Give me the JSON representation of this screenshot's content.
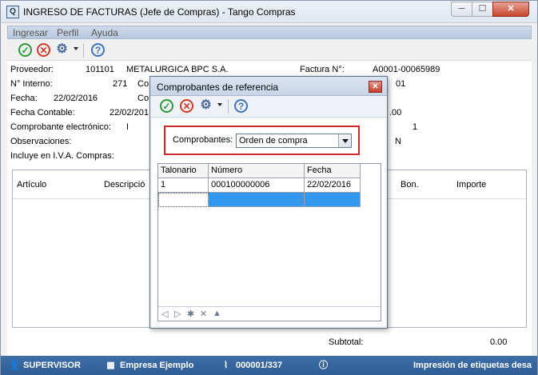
{
  "window": {
    "title": "INGRESO DE FACTURAS (Jefe de Compras) - Tango Compras",
    "controls": {
      "minimize": "─",
      "maximize": "☐",
      "close": "✕"
    }
  },
  "menu": [
    "Ingresar",
    "Perfil",
    "Ayuda"
  ],
  "form": {
    "proveedor_label": "Proveedor:",
    "proveedor_code": "101101",
    "proveedor_name": "METALURGICA BPC S.A.",
    "factura_label": "Factura N°:",
    "factura_value": "A0001-00065989",
    "interno_label": "N° Interno:",
    "interno_value": "271",
    "interno_right_partial": "Co",
    "right_partial_1": "01",
    "fecha_label": "Fecha:",
    "fecha_value": "22/02/2016",
    "fecha_right_partial": "Co",
    "fecha_contable_label": "Fecha Contable:",
    "fecha_contable_value": "22/02/201",
    "right_partial_2": ".00",
    "comprobante_electronico_label": "Comprobante electrónico:",
    "comprobante_electronico_partial": "I",
    "right_partial_3": "1",
    "observaciones_label": "Observaciones:",
    "right_partial_4": "N",
    "iva_label": "Incluye en I.V.A. Compras:"
  },
  "detail_table": {
    "columns": [
      "Artículo",
      "Descripció",
      "Bon.",
      "Importe"
    ]
  },
  "subtotal": {
    "label": "Subtotal:",
    "value": "0.00"
  },
  "statusbar": {
    "user": "SUPERVISOR",
    "company": "Empresa Ejemplo",
    "counter": "000001/337",
    "info_icon": "ⓘ",
    "message": "Impresión de etiquetas desa"
  },
  "dialog": {
    "title": "Comprobantes de referencia",
    "close": "✕",
    "comprobantes_label": "Comprobantes:",
    "comprobantes_value": "Orden de compra",
    "grid_columns": [
      "Talonario",
      "Número",
      "Fecha"
    ],
    "grid_rows": [
      {
        "talonario": "1",
        "numero": "000100000006",
        "fecha": "22/02/2016"
      }
    ],
    "nav": [
      "◁",
      "▷",
      "✱",
      "✕",
      "▲"
    ]
  },
  "icons": {
    "ok": "✓",
    "cancel": "✕",
    "gear": "⚙",
    "help": "?"
  }
}
